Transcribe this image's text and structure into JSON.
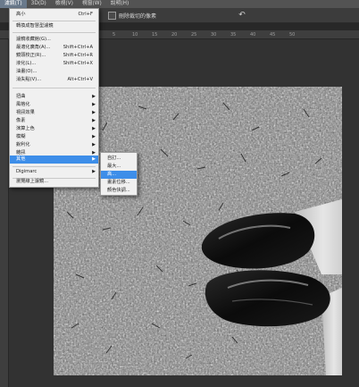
{
  "menubar": {
    "items": [
      {
        "label": "濾鏡(T)",
        "active": true
      },
      {
        "label": "3D(D)",
        "active": false
      },
      {
        "label": "檢視(V)",
        "active": false
      },
      {
        "label": "視窗(W)",
        "active": false
      },
      {
        "label": "說明(H)",
        "active": false
      }
    ]
  },
  "options_bar": {
    "delete_cropped_pixels_label": "刪除裁切的像素",
    "undo_icon": "undo-icon"
  },
  "ruler": {
    "ticks": [
      "5",
      "10",
      "15",
      "20",
      "25",
      "30",
      "35",
      "40",
      "45",
      "50"
    ]
  },
  "filter_menu": {
    "items": [
      {
        "label": "高小",
        "shortcut": "Ctrl+F",
        "submenu": false
      },
      {
        "label": "轉換成智慧型濾鏡",
        "shortcut": "",
        "submenu": false
      },
      {
        "label": "濾鏡收藏館(G)...",
        "shortcut": "",
        "submenu": false
      },
      {
        "label": "最適化廣角(A)...",
        "shortcut": "Shift+Ctrl+A",
        "submenu": false
      },
      {
        "label": "鏡頭校正(R)...",
        "shortcut": "Shift+Ctrl+R",
        "submenu": false
      },
      {
        "label": "液化(L)...",
        "shortcut": "Shift+Ctrl+X",
        "submenu": false
      },
      {
        "label": "油畫(O)...",
        "shortcut": "",
        "submenu": false
      },
      {
        "label": "消失點(V)...",
        "shortcut": "Alt+Ctrl+V",
        "submenu": false
      },
      {
        "label": "扭曲",
        "shortcut": "",
        "submenu": true
      },
      {
        "label": "風格化",
        "shortcut": "",
        "submenu": true
      },
      {
        "label": "視訊效果",
        "shortcut": "",
        "submenu": true
      },
      {
        "label": "像素",
        "shortcut": "",
        "submenu": true
      },
      {
        "label": "演算上色",
        "shortcut": "",
        "submenu": true
      },
      {
        "label": "模糊",
        "shortcut": "",
        "submenu": true
      },
      {
        "label": "銳利化",
        "shortcut": "",
        "submenu": true
      },
      {
        "label": "雜訊",
        "shortcut": "",
        "submenu": true
      },
      {
        "label": "其他",
        "shortcut": "",
        "submenu": true,
        "highlighted": true
      },
      {
        "label": "Digimarc",
        "shortcut": "",
        "submenu": true
      },
      {
        "label": "瀏覽線上濾鏡...",
        "shortcut": "",
        "submenu": false
      }
    ]
  },
  "other_submenu": {
    "items": [
      {
        "label": "自訂...",
        "highlighted": false
      },
      {
        "label": "最大...",
        "highlighted": false
      },
      {
        "label": "高...",
        "highlighted": true
      },
      {
        "label": "畫素位移...",
        "highlighted": false
      },
      {
        "label": "顏色快調...",
        "highlighted": false
      }
    ]
  }
}
